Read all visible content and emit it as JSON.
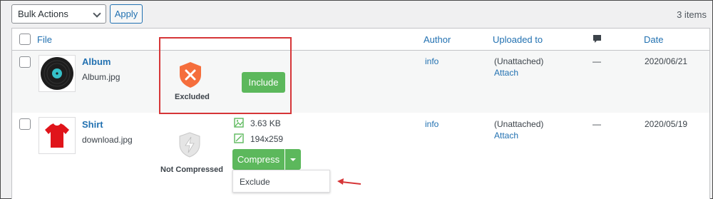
{
  "toolbar": {
    "bulk_actions": "Bulk Actions",
    "apply": "Apply",
    "item_count": "3 items"
  },
  "columns": {
    "file": "File",
    "author": "Author",
    "uploaded_to": "Uploaded to",
    "date": "Date"
  },
  "rows": [
    {
      "title": "Album",
      "filename": "Album.jpg",
      "status": "Excluded",
      "action": "Include",
      "author": "info",
      "uploaded_to": "(Unattached)",
      "attach": "Attach",
      "comments": "—",
      "date": "2020/06/21"
    },
    {
      "title": "Shirt",
      "filename": "download.jpg",
      "status": "Not Compressed",
      "size": "3.63 KB",
      "dimensions": "194x259",
      "action": "Compress",
      "menu_item": "Exclude",
      "author": "info",
      "uploaded_to": "(Unattached)",
      "attach": "Attach",
      "comments": "—",
      "date": "2020/05/19"
    }
  ],
  "colors": {
    "accent": "#2271b1",
    "green": "#5cb85c",
    "highlight": "#d63638",
    "excluded_shield": "#f56e3c"
  }
}
